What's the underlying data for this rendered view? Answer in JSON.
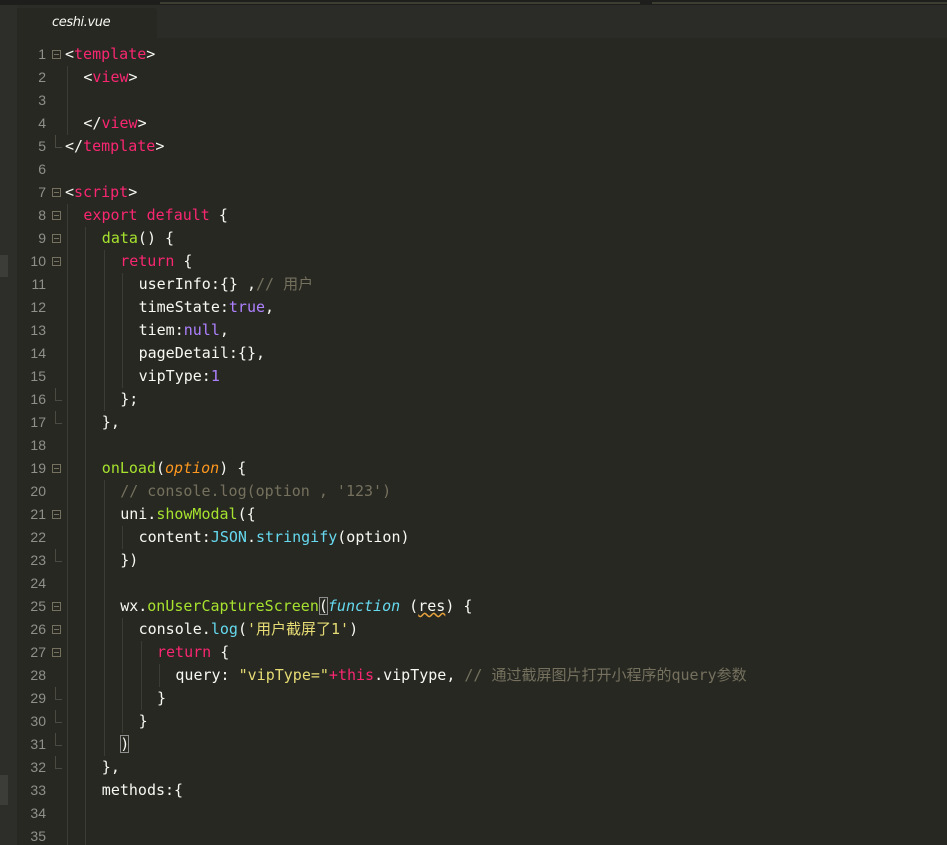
{
  "tabs": [
    {
      "label": "ceshi.vue",
      "active": true
    }
  ],
  "colors": {
    "background": "#272822",
    "tag": "#f92672",
    "function": "#a6e22e",
    "string": "#e6db74",
    "number": "#ae81ff",
    "comment": "#75715e",
    "parameter": "#fd971f",
    "support": "#66d9ef"
  },
  "lines": [
    {
      "n": "1",
      "fold": "open",
      "indent": 0,
      "tokens": [
        [
          "tx",
          "<"
        ],
        [
          "tag",
          "template"
        ],
        [
          "tx",
          ">"
        ]
      ]
    },
    {
      "n": "2",
      "fold": "",
      "indent": 1,
      "tokens": [
        [
          "tx",
          "<"
        ],
        [
          "tag",
          "view"
        ],
        [
          "tx",
          ">"
        ]
      ]
    },
    {
      "n": "3",
      "fold": "",
      "indent": 1,
      "tokens": []
    },
    {
      "n": "4",
      "fold": "",
      "indent": 1,
      "tokens": [
        [
          "tx",
          "</"
        ],
        [
          "tag",
          "view"
        ],
        [
          "tx",
          ">"
        ]
      ]
    },
    {
      "n": "5",
      "fold": "end",
      "indent": 0,
      "tokens": [
        [
          "tx",
          "</"
        ],
        [
          "tag",
          "template"
        ],
        [
          "tx",
          ">"
        ]
      ]
    },
    {
      "n": "6",
      "fold": "",
      "indent": 0,
      "tokens": []
    },
    {
      "n": "7",
      "fold": "open",
      "indent": 0,
      "tokens": [
        [
          "tx",
          "<"
        ],
        [
          "tag",
          "script"
        ],
        [
          "tx",
          ">"
        ]
      ]
    },
    {
      "n": "8",
      "fold": "open",
      "indent": 1,
      "tokens": [
        [
          "kw",
          "export"
        ],
        [
          "tx",
          " "
        ],
        [
          "kw",
          "default"
        ],
        [
          "tx",
          " {"
        ]
      ]
    },
    {
      "n": "9",
      "fold": "open",
      "indent": 2,
      "tokens": [
        [
          "fn",
          "data"
        ],
        [
          "tx",
          "() {"
        ]
      ]
    },
    {
      "n": "10",
      "fold": "open",
      "indent": 3,
      "tokens": [
        [
          "kw",
          "return"
        ],
        [
          "tx",
          " {"
        ]
      ]
    },
    {
      "n": "11",
      "fold": "",
      "indent": 4,
      "tokens": [
        [
          "tx",
          "userInfo:{} ,"
        ],
        [
          "cm",
          "// 用户"
        ]
      ]
    },
    {
      "n": "12",
      "fold": "",
      "indent": 4,
      "tokens": [
        [
          "tx",
          "timeState:"
        ],
        [
          "const",
          "true"
        ],
        [
          "tx",
          ","
        ]
      ]
    },
    {
      "n": "13",
      "fold": "",
      "indent": 4,
      "tokens": [
        [
          "tx",
          "tiem:"
        ],
        [
          "const",
          "null"
        ],
        [
          "tx",
          ","
        ]
      ]
    },
    {
      "n": "14",
      "fold": "",
      "indent": 4,
      "tokens": [
        [
          "tx",
          "pageDetail:{},"
        ]
      ]
    },
    {
      "n": "15",
      "fold": "",
      "indent": 4,
      "tokens": [
        [
          "tx",
          "vipType:"
        ],
        [
          "num",
          "1"
        ]
      ]
    },
    {
      "n": "16",
      "fold": "end",
      "indent": 3,
      "tokens": [
        [
          "tx",
          "};"
        ]
      ]
    },
    {
      "n": "17",
      "fold": "end",
      "indent": 2,
      "tokens": [
        [
          "tx",
          "},"
        ]
      ]
    },
    {
      "n": "18",
      "fold": "",
      "indent": 2,
      "tokens": []
    },
    {
      "n": "19",
      "fold": "open",
      "indent": 2,
      "tokens": [
        [
          "fn",
          "onLoad"
        ],
        [
          "tx",
          "("
        ],
        [
          "param",
          "option"
        ],
        [
          "tx",
          ") {"
        ]
      ]
    },
    {
      "n": "20",
      "fold": "",
      "indent": 3,
      "tokens": [
        [
          "cm",
          "// console.log(option , '123')"
        ]
      ]
    },
    {
      "n": "21",
      "fold": "open",
      "indent": 3,
      "tokens": [
        [
          "tx",
          "uni."
        ],
        [
          "fn",
          "showModal"
        ],
        [
          "tx",
          "({"
        ]
      ]
    },
    {
      "n": "22",
      "fold": "",
      "indent": 4,
      "tokens": [
        [
          "tx",
          "content:"
        ],
        [
          "support",
          "JSON"
        ],
        [
          "tx",
          "."
        ],
        [
          "support",
          "stringify"
        ],
        [
          "tx",
          "(option)"
        ]
      ]
    },
    {
      "n": "23",
      "fold": "end",
      "indent": 3,
      "tokens": [
        [
          "tx",
          "})"
        ]
      ]
    },
    {
      "n": "24",
      "fold": "",
      "indent": 3,
      "tokens": []
    },
    {
      "n": "25",
      "fold": "open",
      "indent": 3,
      "tokens": [
        [
          "tx",
          "wx."
        ],
        [
          "fn",
          "onUserCaptureScreen"
        ],
        [
          "brk",
          "("
        ],
        [
          "ital",
          "function"
        ],
        [
          "tx",
          " ("
        ],
        [
          "squig",
          "res"
        ],
        [
          "tx",
          ") {"
        ]
      ]
    },
    {
      "n": "26",
      "fold": "open",
      "indent": 4,
      "tokens": [
        [
          "tx",
          "console."
        ],
        [
          "support",
          "log"
        ],
        [
          "tx",
          "("
        ],
        [
          "str",
          "'用户截屏了1'"
        ],
        [
          "tx",
          ")"
        ]
      ]
    },
    {
      "n": "27",
      "fold": "open",
      "indent": 5,
      "tokens": [
        [
          "kw",
          "return"
        ],
        [
          "tx",
          " {"
        ]
      ]
    },
    {
      "n": "28",
      "fold": "",
      "indent": 6,
      "tokens": [
        [
          "tx",
          "query: "
        ],
        [
          "str",
          "\"vipType=\""
        ],
        [
          "kw",
          "+"
        ],
        [
          "kw",
          "this"
        ],
        [
          "tx",
          ".vipType, "
        ],
        [
          "cm",
          "// 通过截屏图片打开小程序的query参数"
        ]
      ]
    },
    {
      "n": "29",
      "fold": "end",
      "indent": 5,
      "tokens": [
        [
          "tx",
          "}"
        ]
      ]
    },
    {
      "n": "30",
      "fold": "end",
      "indent": 4,
      "tokens": [
        [
          "tx",
          "}"
        ]
      ]
    },
    {
      "n": "31",
      "fold": "end",
      "indent": 3,
      "tokens": [
        [
          "brk",
          ")"
        ]
      ]
    },
    {
      "n": "32",
      "fold": "end",
      "indent": 2,
      "tokens": [
        [
          "tx",
          "},"
        ]
      ]
    },
    {
      "n": "33",
      "fold": "",
      "indent": 2,
      "tokens": [
        [
          "tx",
          "methods:{"
        ]
      ]
    },
    {
      "n": "34",
      "fold": "",
      "indent": 2,
      "tokens": []
    },
    {
      "n": "35",
      "fold": "",
      "indent": 2,
      "tokens": []
    }
  ]
}
